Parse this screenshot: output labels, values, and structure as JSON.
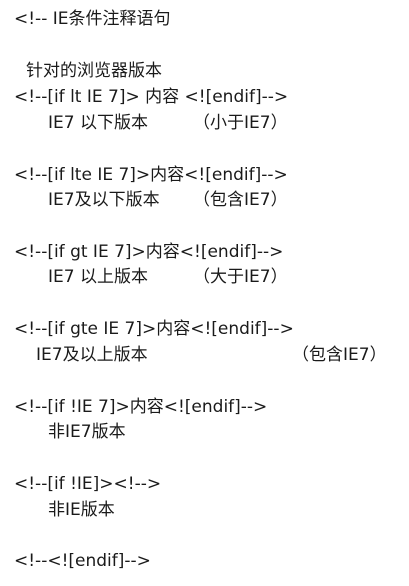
{
  "document": {
    "header": "<!-- IE条件注释语句",
    "subheader": "针对的浏览器版本",
    "blocks": [
      {
        "code": "<!--[if lt IE 7]> 内容 <![endif]-->",
        "desc": "IE7 以下版本",
        "note": "（小于IE7）"
      },
      {
        "code": "<!--[if lte IE 7]>内容<![endif]-->",
        "desc": "IE7及以下版本",
        "note": "（包含IE7）"
      },
      {
        "code": "<!--[if gt IE 7]>内容<![endif]-->",
        "desc": "IE7 以上版本",
        "note": "（大于IE7）"
      },
      {
        "code": "<!--[if gte IE 7]>内容<![endif]-->",
        "desc": "IE7及以上版本",
        "note": "（包含IE7）"
      },
      {
        "code": "<!--[if !IE 7]>内容<![endif]-->",
        "desc": "非IE7版本"
      },
      {
        "code": "<!--[if !IE]><!-->",
        "desc": "非IE版本"
      }
    ],
    "footer": "<!--<![endif]-->"
  }
}
